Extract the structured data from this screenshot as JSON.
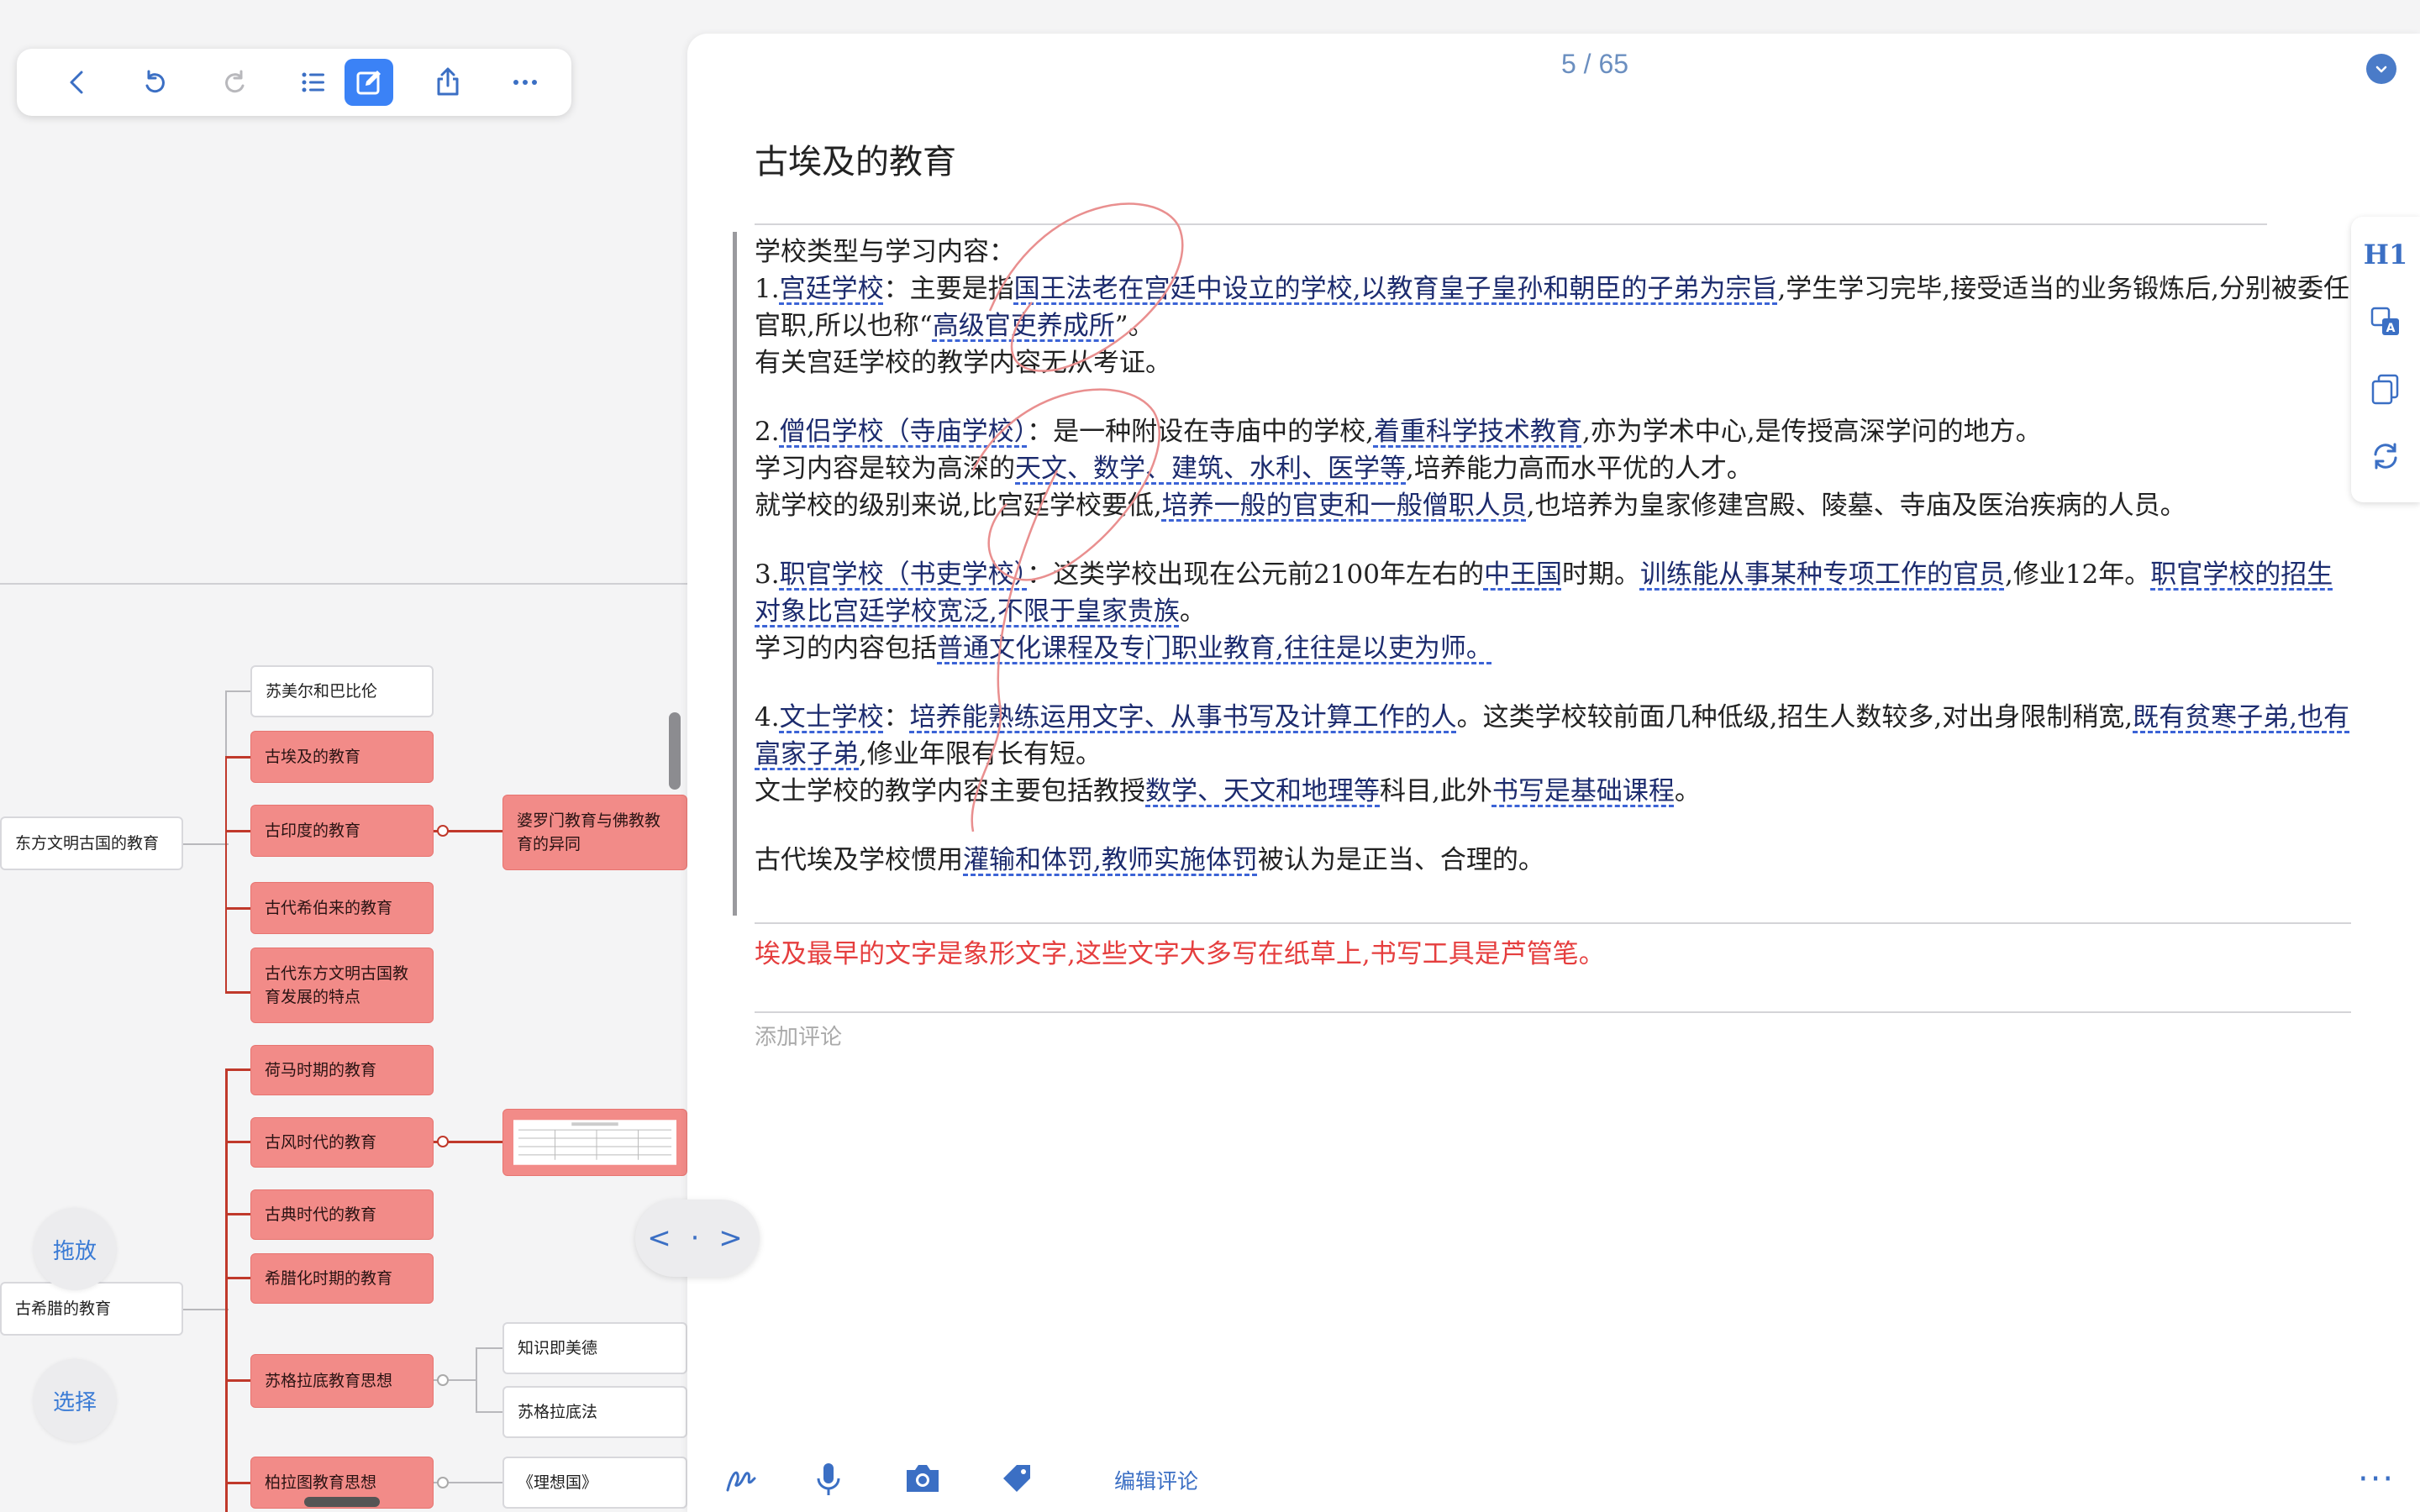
{
  "toolbar": {
    "buttons": [
      "back-icon",
      "undo-icon",
      "redo-icon",
      "outline-icon",
      "edit-icon",
      "share-icon",
      "more-icon"
    ]
  },
  "mindmap": {
    "roots": [
      "东方文明古国的教育",
      "古希腊的教育"
    ],
    "nodes": {
      "sumer": "苏美尔和巴比伦",
      "egypt": "古埃及的教育",
      "india": "古印度的教育",
      "hebrew": "古代希伯来的教育",
      "features": "古代东方文明古国教育发展的特点",
      "brahmin": "婆罗门教育与佛教教育的异同",
      "homer": "荷马时期的教育",
      "archaic": "古风时代的教育",
      "classical": "古典时代的教育",
      "hellenistic": "希腊化时期的教育",
      "socrates": "苏格拉底教育思想",
      "virtue": "知识即美德",
      "method": "苏格拉底法",
      "plato": "柏拉图教育思想",
      "republic": "《理想国》"
    },
    "drag_label": "拖放",
    "select_label": "选择",
    "toggle_label": "< · >"
  },
  "doc": {
    "pager": "5 / 65",
    "title": "古埃及的教育",
    "intro": "学校类型与学习内容：",
    "p1": {
      "a": "1.",
      "b": "宫廷学校",
      "c": "：主要是指",
      "d": "国王法老在宫廷中设立的学校,以教育皇子皇孙和朝臣的子弟为宗旨",
      "e": ",学生学习完毕,接受适当的业务锻炼后,分别被委任官职,所以也称“",
      "f": "高级官吏养成所",
      "g": "”。",
      "h": "有关宫廷学校的教学内容无从考证。"
    },
    "p2": {
      "a": "2.",
      "b": "僧侣学校（寺庙学校）",
      "c": "：是一种附设在寺庙中的学校,",
      "d": "着重科学技术教育",
      "e": ",亦为学术中心,是传授高深学问的地方。",
      "f": "学习内容是较为高深的",
      "g": "天文、数学、建筑、水利、医学等",
      "h": ",培养能力高而水平优的人才。",
      "i": "就学校的级别来说,比宫廷学校要低,",
      "j": "培养一般的官吏和一般僧职人员",
      "k": ",也培养为皇家修建宫殿、陵墓、寺庙及医治疾病的人员。"
    },
    "p3": {
      "a": "3.",
      "b": "职官学校（书吏学校）",
      "c": "：这类学校出现在公元前2100年左右的",
      "d": "中王国",
      "e": "时期。",
      "f": "训练能从事某种专项工作的官员",
      "g": ",修业12年。",
      "h": "职官学校的招生对象比宫廷学校宽泛,不限于皇家贵族",
      "i": "。",
      "j": "学习的内容包括",
      "k": "普通文化课程及专门职业教育,往往是以吏为师。"
    },
    "p4": {
      "a": "4.",
      "b": "文士学校",
      "c": "：",
      "d": "培养能熟练运用文字、从事书写及计算工作的人",
      "e": "。这类学校较前面几种低级,招生人数较多,对出身限制稍宽,",
      "f": "既有贫寒子弟,也有富家子弟",
      "g": ",修业年限有长有短。",
      "h": "文士学校的教学内容主要包括教授",
      "i": "数学、天文和地理等",
      "j": "科目,此外",
      "k": "书写是基础课程",
      "l": "。"
    },
    "p5": {
      "a": "古代埃及学校惯用",
      "b": "灌输和体罚,教师实施体罚",
      "c": "被认为是正当、合理的。"
    },
    "note": "埃及最早的文字是象形文字,这些文字大多写在纸草上,书写工具是芦管笔。",
    "comment_placeholder": "添加评论",
    "edit_comment": "编辑评论",
    "heading_tool": "H1"
  },
  "colors": {
    "accent": "#3b82f6",
    "node_pink": "#f28b88",
    "note_red": "#e53e3e",
    "highlight_text": "#1c2b6e"
  }
}
